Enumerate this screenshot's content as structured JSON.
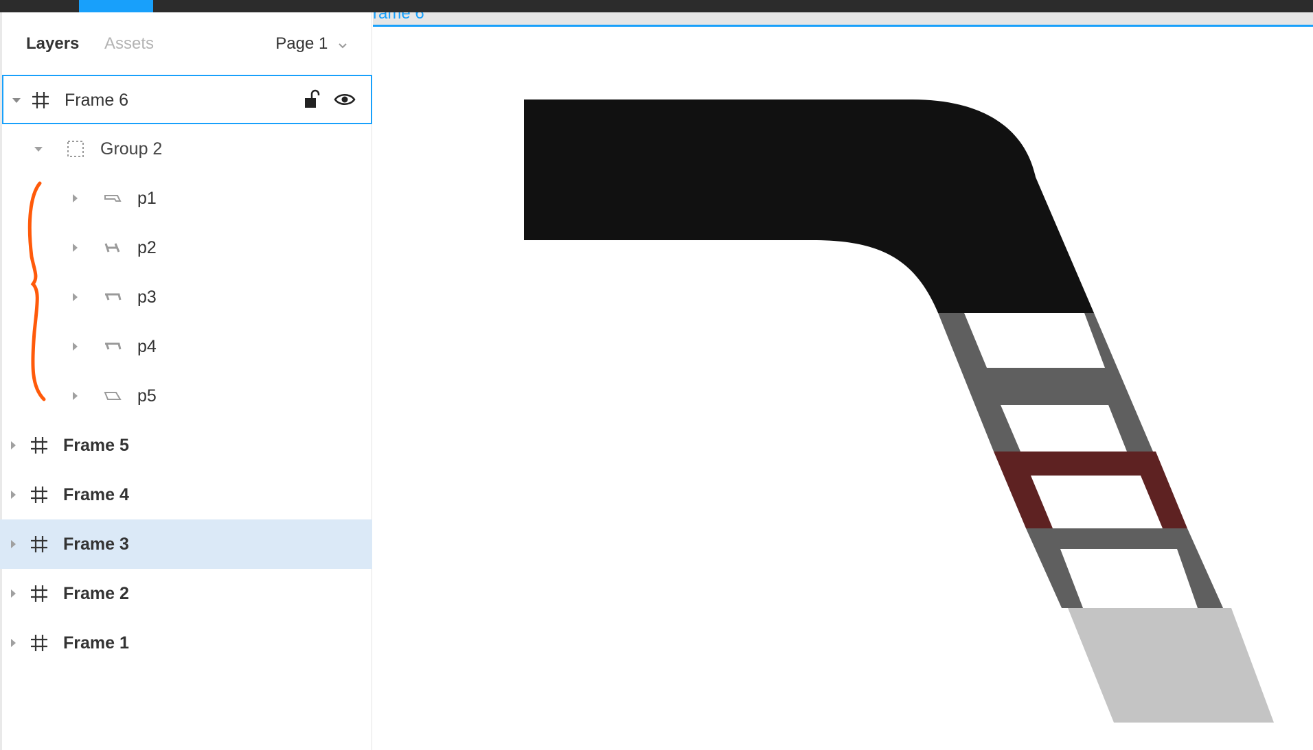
{
  "tabs": {
    "layers": "Layers",
    "assets": "Assets",
    "page": "Page 1"
  },
  "layers": {
    "frame6": "Frame 6",
    "group2": "Group 2",
    "p1": "p1",
    "p2": "p2",
    "p3": "p3",
    "p4": "p4",
    "p5": "p5",
    "frame5": "Frame 5",
    "frame4": "Frame 4",
    "frame3": "Frame 3",
    "frame2": "Frame 2",
    "frame1": "Frame 1"
  },
  "canvas": {
    "frame_label": "rame 6"
  },
  "colors": {
    "accent": "#18a0fb",
    "selection_bg": "#dbe9f7",
    "annotation": "#ff5a0a",
    "shape_dark": "#111111",
    "shape_gray": "#5f5f5f",
    "shape_red": "#5e2222",
    "shape_light": "#c4c4c4"
  }
}
